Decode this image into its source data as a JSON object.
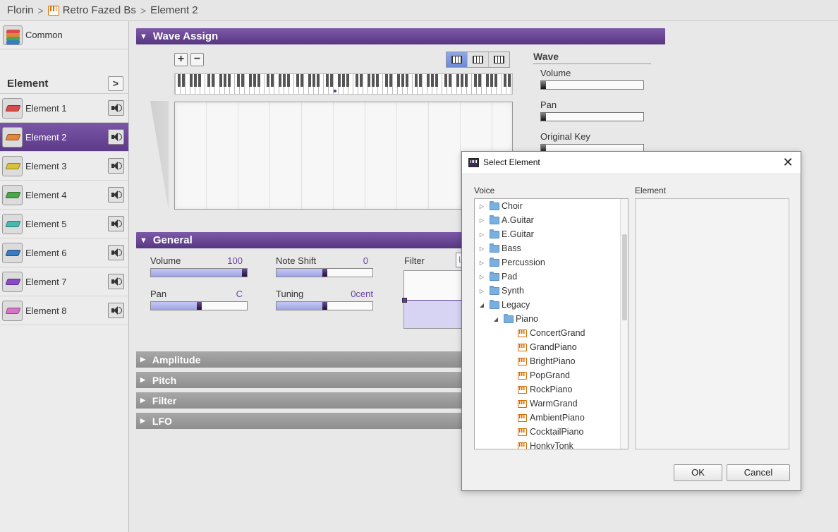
{
  "breadcrumb": {
    "items": [
      "Florin",
      "Retro Fazed Bs",
      "Element 2"
    ]
  },
  "sidebar": {
    "common_label": "Common",
    "element_header": "Element",
    "arrow_label": ">",
    "elements": [
      {
        "label": "Element 1",
        "color": "#d94a4a"
      },
      {
        "label": "Element 2",
        "color": "#e8833a"
      },
      {
        "label": "Element 3",
        "color": "#d8c23a"
      },
      {
        "label": "Element 4",
        "color": "#4aa84a"
      },
      {
        "label": "Element 5",
        "color": "#45b8b0"
      },
      {
        "label": "Element 6",
        "color": "#3a7ac0"
      },
      {
        "label": "Element 7",
        "color": "#8a4ac8"
      },
      {
        "label": "Element 8",
        "color": "#d873c8"
      }
    ],
    "active_index": 1
  },
  "wave_assign": {
    "title": "Wave Assign",
    "add_label": "+",
    "remove_label": "−",
    "wave": {
      "title": "Wave",
      "volume_label": "Volume",
      "pan_label": "Pan",
      "original_key_label": "Original Key"
    }
  },
  "general": {
    "title": "General",
    "volume": {
      "label": "Volume",
      "value": "100",
      "fraction": 1.0
    },
    "note_shift": {
      "label": "Note Shift",
      "value": "0",
      "fraction": 0.5
    },
    "pan": {
      "label": "Pan",
      "value": "C",
      "fraction": 0.5
    },
    "tuning": {
      "label": "Tuning",
      "value": "0cent",
      "fraction": 0.5
    },
    "filter_label": "Filter",
    "filter_select_value": "L"
  },
  "sections": [
    "Amplitude",
    "Pitch",
    "Filter",
    "LFO"
  ],
  "dialog": {
    "title": "Select Element",
    "voice_header": "Voice",
    "element_header": "Element",
    "tree": [
      {
        "label": "Choir",
        "type": "folder",
        "level": 0,
        "expanded": false
      },
      {
        "label": "A.Guitar",
        "type": "folder",
        "level": 0,
        "expanded": false
      },
      {
        "label": "E.Guitar",
        "type": "folder",
        "level": 0,
        "expanded": false
      },
      {
        "label": "Bass",
        "type": "folder",
        "level": 0,
        "expanded": false
      },
      {
        "label": "Percussion",
        "type": "folder",
        "level": 0,
        "expanded": false
      },
      {
        "label": "Pad",
        "type": "folder",
        "level": 0,
        "expanded": false
      },
      {
        "label": "Synth",
        "type": "folder",
        "level": 0,
        "expanded": false
      },
      {
        "label": "Legacy",
        "type": "folder",
        "level": 0,
        "expanded": true
      },
      {
        "label": "Piano",
        "type": "folder",
        "level": 1,
        "expanded": true
      },
      {
        "label": "ConcertGrand",
        "type": "voice",
        "level": 2
      },
      {
        "label": "GrandPiano",
        "type": "voice",
        "level": 2
      },
      {
        "label": "BrightPiano",
        "type": "voice",
        "level": 2
      },
      {
        "label": "PopGrand",
        "type": "voice",
        "level": 2
      },
      {
        "label": "RockPiano",
        "type": "voice",
        "level": 2
      },
      {
        "label": "WarmGrand",
        "type": "voice",
        "level": 2
      },
      {
        "label": "AmbientPiano",
        "type": "voice",
        "level": 2
      },
      {
        "label": "CocktailPiano",
        "type": "voice",
        "level": 2
      },
      {
        "label": "HonkyTonk",
        "type": "voice",
        "level": 2
      }
    ],
    "ok_label": "OK",
    "cancel_label": "Cancel",
    "close_icon": "close-icon"
  }
}
